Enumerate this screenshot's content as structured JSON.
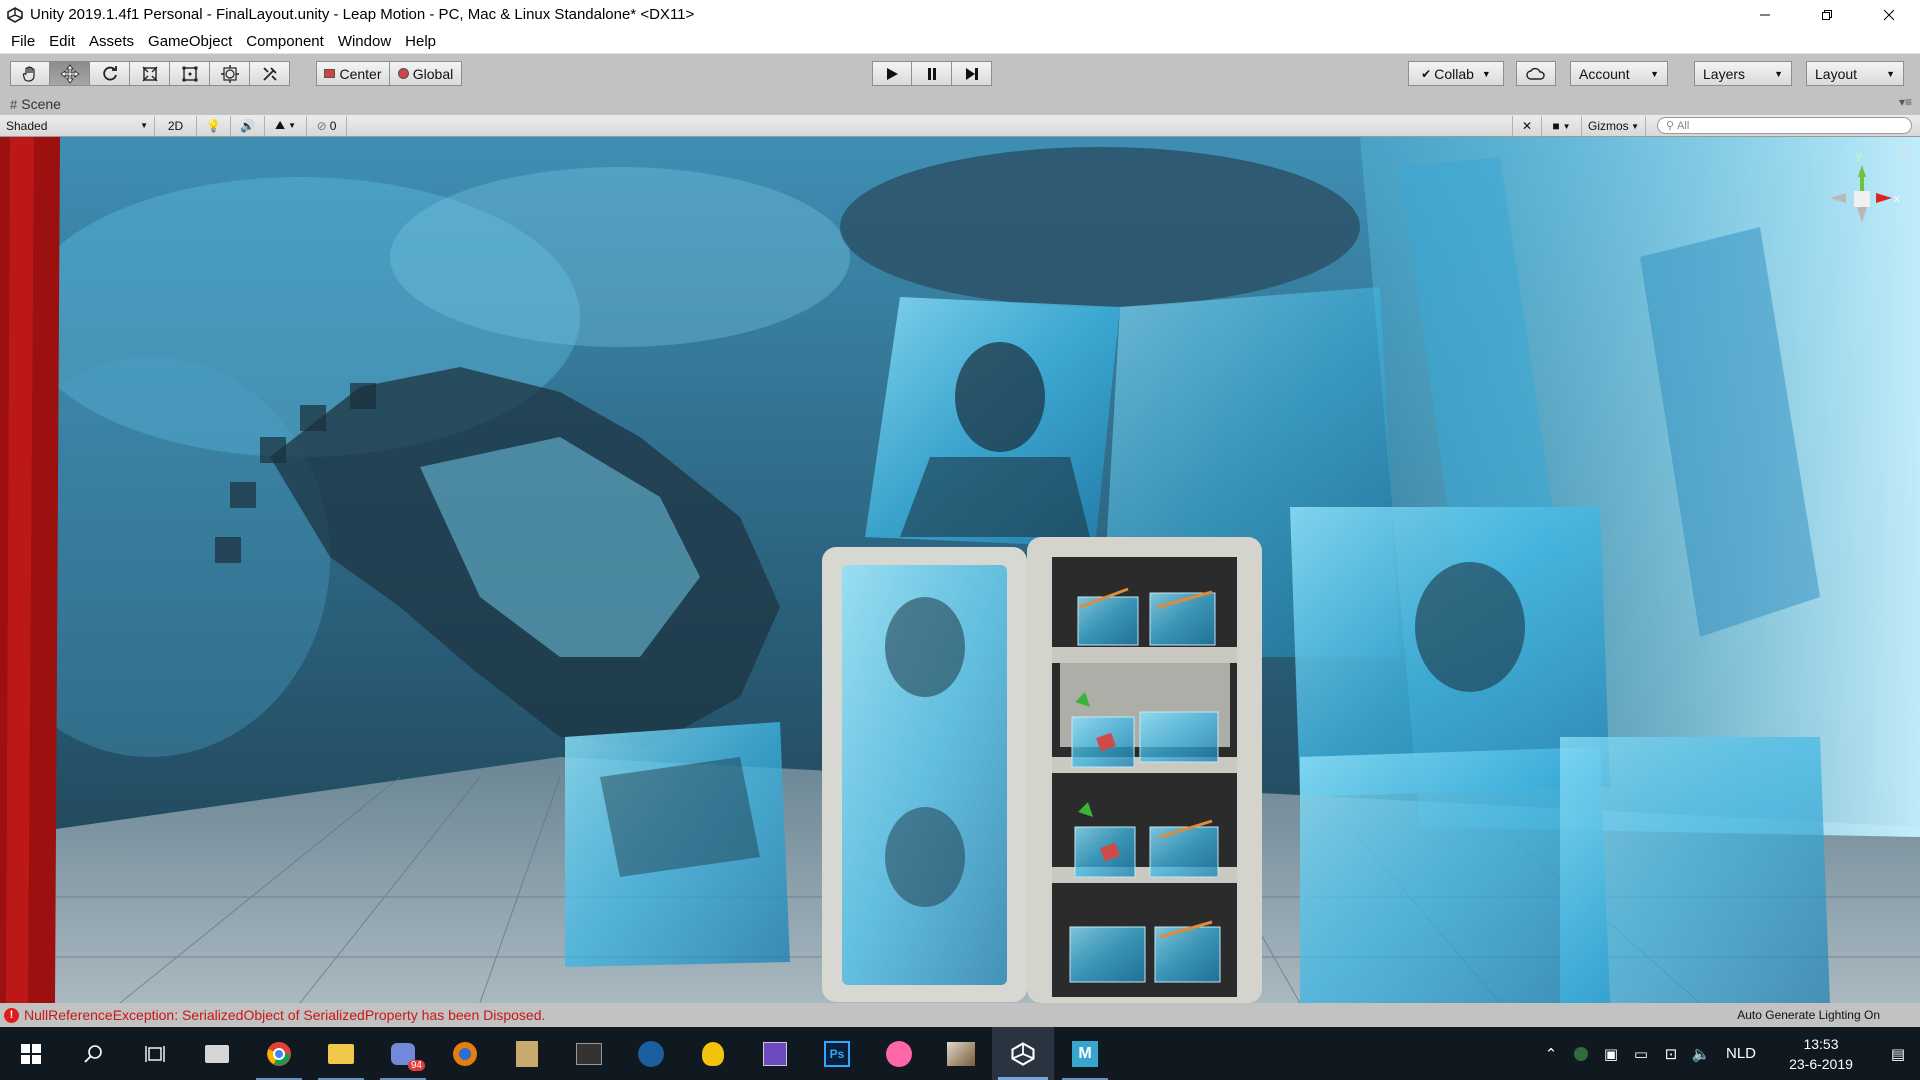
{
  "window": {
    "title": "Unity 2019.1.4f1 Personal - FinalLayout.unity - Leap Motion - PC, Mac & Linux Standalone* <DX11>"
  },
  "menu": [
    "File",
    "Edit",
    "Assets",
    "GameObject",
    "Component",
    "Window",
    "Help"
  ],
  "toolbar": {
    "tools": [
      "hand-tool",
      "move-tool",
      "rotate-tool",
      "scale-tool",
      "rect-tool",
      "transform-tool",
      "custom-tool"
    ],
    "pivot_label": "Center",
    "space_label": "Global",
    "collab_label": "Collab",
    "account_label": "Account",
    "layers_label": "Layers",
    "layout_label": "Layout"
  },
  "scene_tab": {
    "label": "Scene"
  },
  "scene_toolbar": {
    "draw_mode": "Shaded",
    "mode_2d": "2D",
    "hidden_count": "0",
    "gizmos_label": "Gizmos",
    "search_placeholder": "All"
  },
  "gizmo": {
    "y_label": "y",
    "x_label": "x"
  },
  "status": {
    "error_text": "NullReferenceException: SerializedObject of SerializedProperty has been Disposed.",
    "right_text": "Auto Generate Lighting On"
  },
  "taskbar": {
    "badge": "94",
    "lang": "NLD",
    "time": "13:53",
    "date": "23-6-2019"
  },
  "colors": {
    "error": "#e01d1d",
    "scene_blue": "#4ec3ea",
    "taskbar": "#101820"
  }
}
